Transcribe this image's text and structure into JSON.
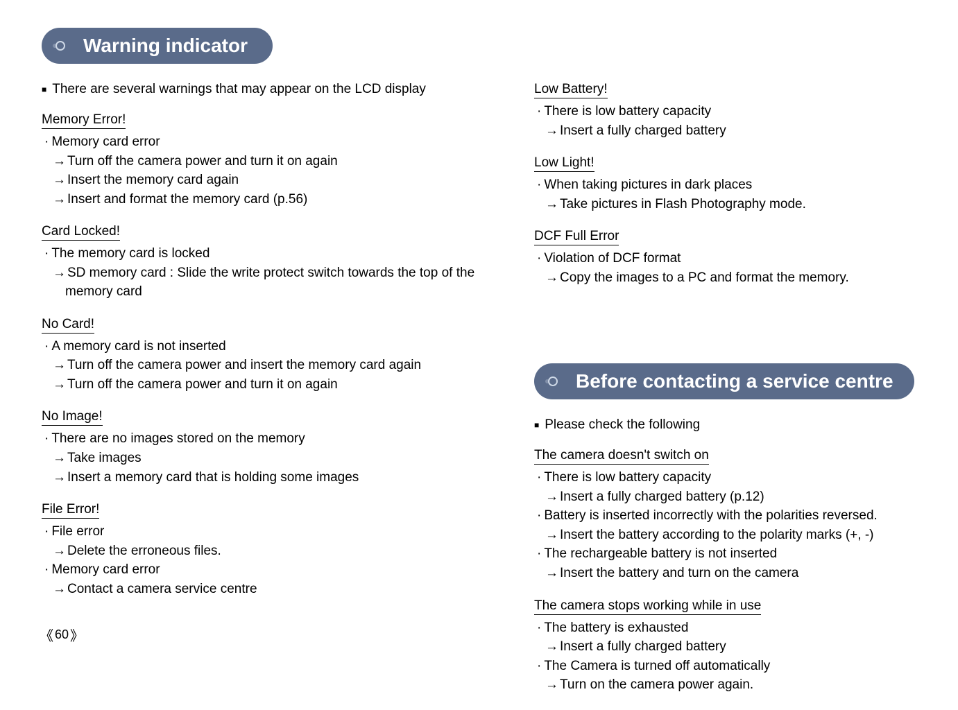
{
  "pill1": "Warning indicator",
  "lead1": "There are several warnings that may appear on the LCD display",
  "left": {
    "memoryError": {
      "title": "Memory Error!",
      "item1": "Memory card error",
      "a1": "Turn off the camera power and turn it on again",
      "a2": "Insert the memory card again",
      "a3": "Insert and format the memory card (p.56)"
    },
    "cardLocked": {
      "title": "Card Locked!",
      "item1": "The memory card is locked",
      "a1": "SD memory card : Slide the write protect switch towards the top of the memory card"
    },
    "noCard": {
      "title": "No Card!",
      "item1": "A memory card is not inserted",
      "a1": "Turn off the camera power and insert the memory card again",
      "a2": "Turn off the camera power and turn it on again"
    },
    "noImage": {
      "title": "No Image!",
      "item1": "There are no images stored on the memory",
      "a1": "Take images",
      "a2": "Insert a memory card that is holding some images"
    },
    "fileError": {
      "title": "File Error!",
      "item1": "File error",
      "a1": "Delete the erroneous files.",
      "item2": "Memory card error",
      "a2": "Contact a camera service centre"
    }
  },
  "right": {
    "lowBattery": {
      "title": "Low Battery!",
      "item1": "There is low battery capacity",
      "a1": "Insert a fully charged battery"
    },
    "lowLight": {
      "title": "Low Light!",
      "item1": "When taking pictures in dark places",
      "a1": "Take pictures in Flash Photography mode."
    },
    "dcf": {
      "title": "DCF Full Error",
      "item1": "Violation of DCF format",
      "a1": "Copy the images to a PC and format the memory."
    }
  },
  "pill2": "Before contacting a service centre",
  "lead2": "Please check the following",
  "bc": {
    "noSwitch": {
      "title": "The camera doesn't switch on",
      "item1": "There is low battery capacity",
      "a1": "Insert a fully charged battery (p.12)",
      "item2": "Battery is inserted incorrectly with the polarities reversed.",
      "a2": "Insert the battery according to the polarity marks (+, -)",
      "item3": "The rechargeable battery is not inserted",
      "a3": "Insert the battery and turn on the camera"
    },
    "stops": {
      "title": "The camera stops working while in use",
      "item1": "The battery is exhausted",
      "a1": "Insert a fully charged battery",
      "item2": "The Camera is turned off automatically",
      "a2": "Turn on the camera power again."
    }
  },
  "pagenum": "60"
}
